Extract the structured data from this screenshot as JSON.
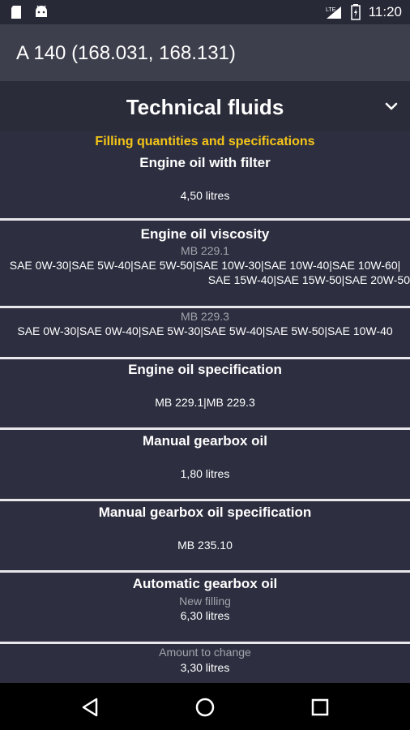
{
  "status_bar": {
    "time": "11:20",
    "left_icons": [
      "sd-card-icon",
      "android-icon"
    ],
    "right_icons": [
      "signal-icon",
      "battery-icon"
    ]
  },
  "app_bar": {
    "title": "A 140 (168.031, 168.131)"
  },
  "section": {
    "title": "Technical fluids",
    "expand_icon": "chevron-down-icon"
  },
  "content": {
    "subtitle": "Filling quantities and specifications",
    "engine_oil_filter": {
      "title": "Engine oil with filter",
      "value": "4,50 litres"
    },
    "engine_oil_viscosity": {
      "title": "Engine oil viscosity",
      "mb2291": {
        "label": "MB 229.1",
        "line1": "SAE 0W-30|SAE 5W-40|SAE 5W-50|SAE 10W-30|SAE 10W-40|SAE 10W-60|",
        "line2": "SAE 15W-40|SAE 15W-50|SAE 20W-50"
      },
      "mb2293": {
        "label": "MB 229.3",
        "line1": "SAE 0W-30|SAE 0W-40|SAE 5W-30|SAE 5W-40|SAE 5W-50|SAE 10W-40"
      }
    },
    "engine_oil_spec": {
      "title": "Engine oil specification",
      "value": "MB 229.1|MB 229.3"
    },
    "manual_gearbox_oil": {
      "title": "Manual gearbox oil",
      "value": "1,80 litres"
    },
    "manual_gearbox_spec": {
      "title": "Manual gearbox oil specification",
      "value": "MB 235.10"
    },
    "auto_gearbox_oil": {
      "title": "Automatic gearbox oil",
      "new_filling_label": "New filling",
      "new_filling_value": "6,30 litres",
      "change_label": "Amount to change",
      "change_value": "3,30 litres"
    }
  },
  "nav_bar": {
    "back": "back-icon",
    "home": "home-icon",
    "recents": "recents-icon"
  },
  "colors": {
    "background": "#2d2f40",
    "app_bar": "#3d3f4c",
    "accent": "#f5c518",
    "divider": "#e8e8ec"
  }
}
